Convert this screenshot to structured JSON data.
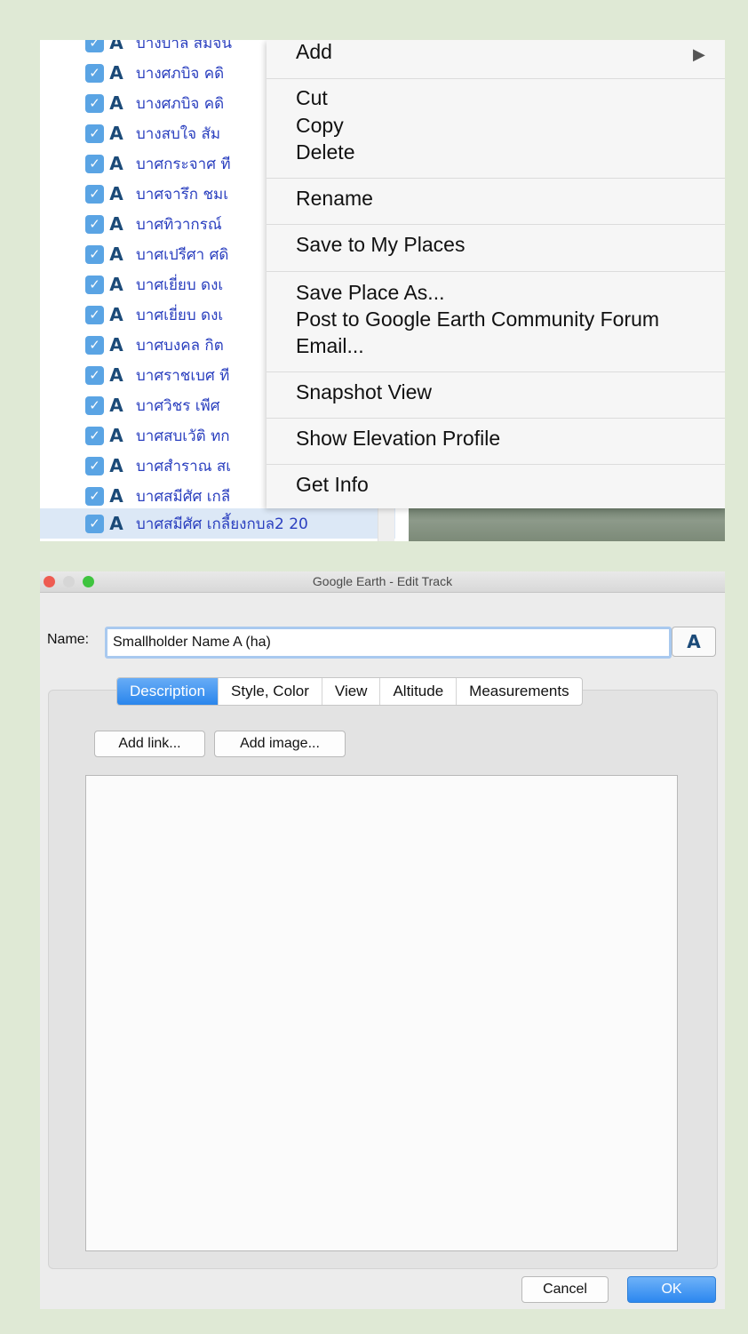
{
  "places_list": {
    "items": [
      {
        "name": "บางบาล สมจน"
      },
      {
        "name": "บางศภบิจ คดิ"
      },
      {
        "name": "บางศภบิจ คดิ"
      },
      {
        "name": "บางสบใจ สัม"
      },
      {
        "name": "บาศกระจาศ ที"
      },
      {
        "name": "บาศจารึก ชมเ"
      },
      {
        "name": "บาศทิวากรณ์"
      },
      {
        "name": "บาศเปรีศา ศดิ"
      },
      {
        "name": "บาศเยี่ยบ ดงเ"
      },
      {
        "name": "บาศเยี่ยบ ดงเ"
      },
      {
        "name": "บาศบงคล กิต"
      },
      {
        "name": "บาศราชเบศ ที"
      },
      {
        "name": "บาศวิชร เพีศ"
      },
      {
        "name": "บาศสบเวัติ ทก"
      },
      {
        "name": "บาศสำราณ สเ"
      },
      {
        "name": "บาศสมีศัศ เกลี"
      },
      {
        "name": "บาศสมีศัศ เกลี้ยงกบล2 20"
      }
    ],
    "check_glyph": "✓",
    "track_glyph": "A"
  },
  "context_menu": {
    "items": [
      {
        "label": "Add",
        "has_submenu": true
      },
      {
        "label": "Cut"
      },
      {
        "label": "Copy"
      },
      {
        "label": "Delete"
      },
      {
        "label": "Rename"
      },
      {
        "label": "Save to My Places"
      },
      {
        "label": "Save Place As..."
      },
      {
        "label": "Post to Google Earth Community Forum"
      },
      {
        "label": "Email..."
      },
      {
        "label": "Snapshot View"
      },
      {
        "label": "Show Elevation Profile"
      },
      {
        "label": "Get Info"
      }
    ],
    "submenu_arrow": "▶"
  },
  "dialog": {
    "title": "Google Earth - Edit Track",
    "name_label": "Name:",
    "name_value": "Smallholder Name A (ha)",
    "icon_button_glyph": "A",
    "tabs": [
      {
        "label": "Description",
        "active": true
      },
      {
        "label": "Style, Color"
      },
      {
        "label": "View"
      },
      {
        "label": "Altitude"
      },
      {
        "label": "Measurements"
      }
    ],
    "add_link_label": "Add link...",
    "add_image_label": "Add image...",
    "description_value": "",
    "cancel_label": "Cancel",
    "ok_label": "OK"
  },
  "colors": {
    "background": "#dfe9d5",
    "checkbox": "#5aa4e4",
    "link_text": "#2a3fbf",
    "selected_row": "#dce8f6",
    "accent_blue": "#2a86ec",
    "close": "#ee5b52",
    "minimize": "#d6d6d6",
    "zoom": "#3fc43f"
  }
}
